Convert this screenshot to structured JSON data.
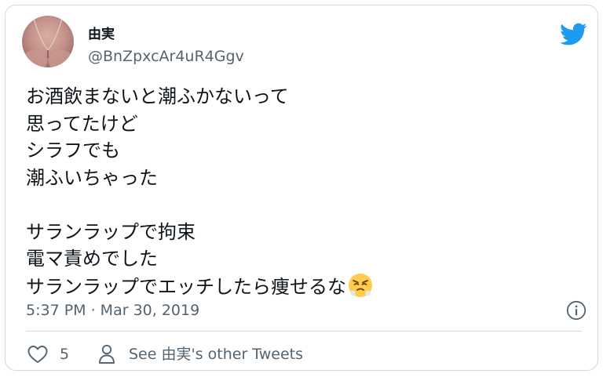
{
  "author": {
    "display_name": "由実",
    "handle": "@BnZpxcAr4uR4Ggv"
  },
  "tweet": {
    "lines": [
      "お酒飲まないと潮ふかないって",
      "思ってたけど",
      "シラフでも",
      "潮ふいちゃった",
      "",
      "サランラップで拘束",
      "電マ責めでした",
      "サランラップでエッチしたら痩せるな"
    ],
    "emoji": "face-with-steam-from-nose",
    "timestamp": "5:37 PM · Mar 30, 2019"
  },
  "actions": {
    "like_count": "5",
    "other_tweets_label": "See 由実's other Tweets"
  },
  "icons": {
    "brand": "twitter-bird-icon",
    "info": "info-icon",
    "like": "heart-icon",
    "profile": "person-icon"
  },
  "colors": {
    "brand_blue": "#1d9bf0",
    "text_primary": "#0f1419",
    "text_secondary": "#536471",
    "border": "#cfd9de"
  }
}
